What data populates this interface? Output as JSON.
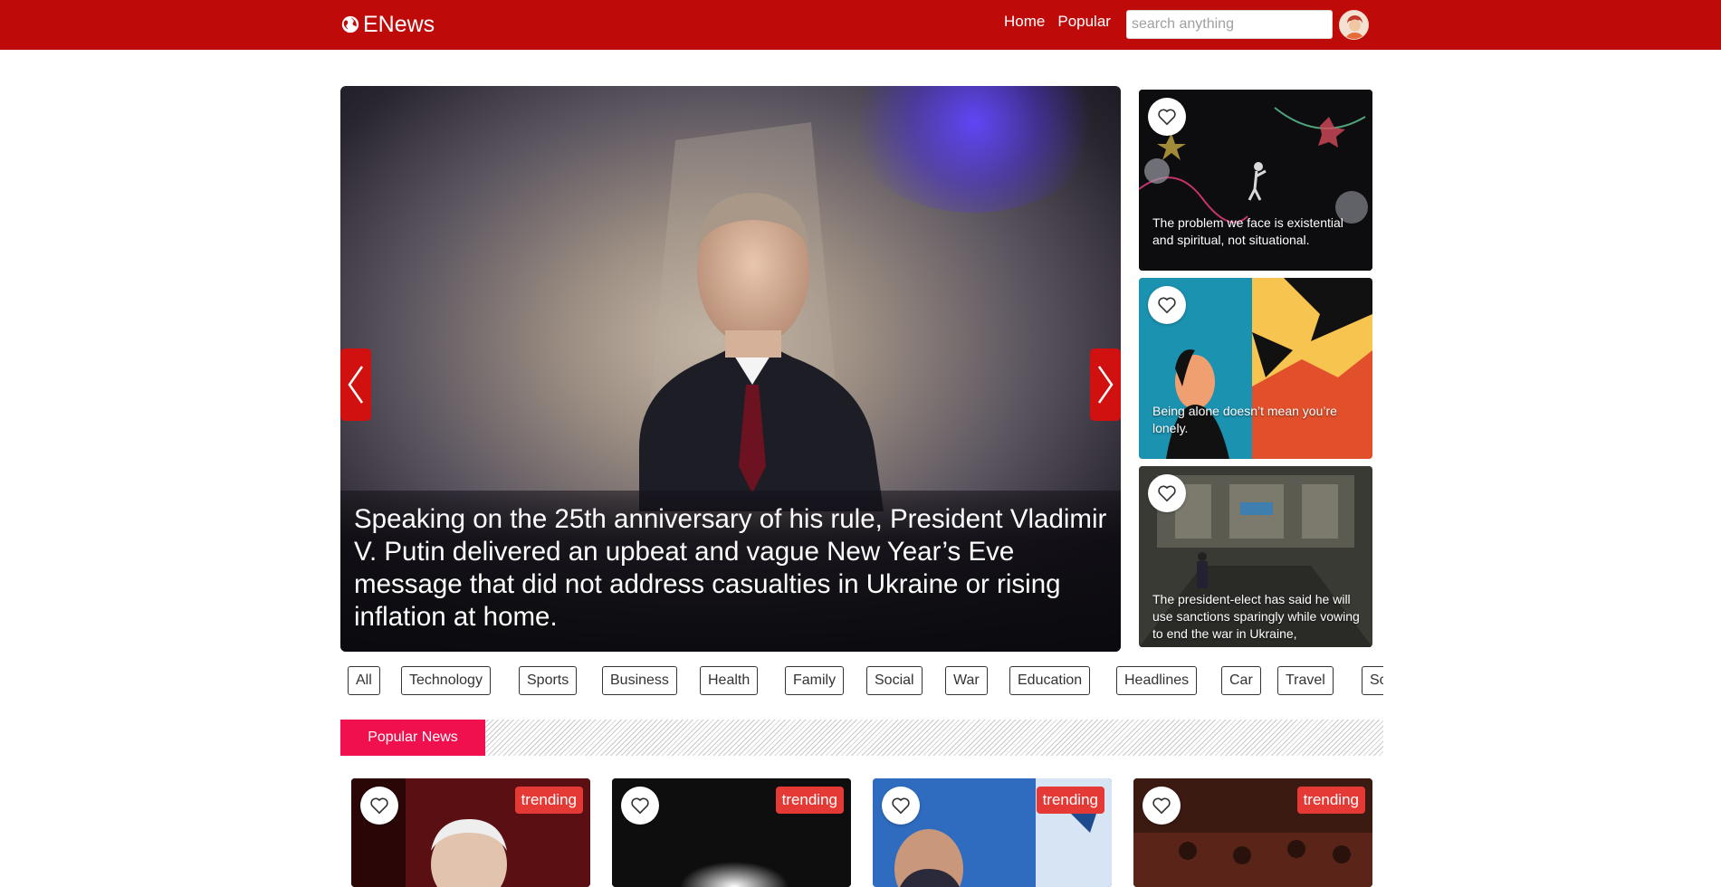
{
  "header": {
    "brand": "ENews",
    "nav": [
      "Home",
      "Popular"
    ],
    "search_placeholder": "search anything"
  },
  "hero": {
    "caption": "Speaking on the 25th anniversary of his rule, President Vladimir V. Putin delivered an upbeat and vague New Year’s Eve message that did not address casualties in Ukraine or rising inflation at home."
  },
  "side_cards": [
    {
      "text": "The problem we face is existential and spiritual, not situational."
    },
    {
      "text": "Being alone doesn’t mean you’re lonely."
    },
    {
      "text": "The president-elect has said he will use sanctions sparingly while vowing to end the war in Ukraine,"
    }
  ],
  "categories": [
    "All",
    "Technology",
    "Sports",
    "Business",
    "Health",
    "Family",
    "Social",
    "War",
    "Education",
    "Headlines",
    "Car",
    "Travel",
    "Sc"
  ],
  "popular": {
    "title": "Popular News",
    "cards": [
      {
        "badge": "trending"
      },
      {
        "badge": "trending"
      },
      {
        "badge": "trending"
      },
      {
        "badge": "trending"
      }
    ]
  },
  "colors": {
    "header_bg": "#bf0a0a",
    "arrow_bg": "#d11010",
    "popular_label_bg": "#f0104e",
    "badge_bg": "#e53935"
  }
}
